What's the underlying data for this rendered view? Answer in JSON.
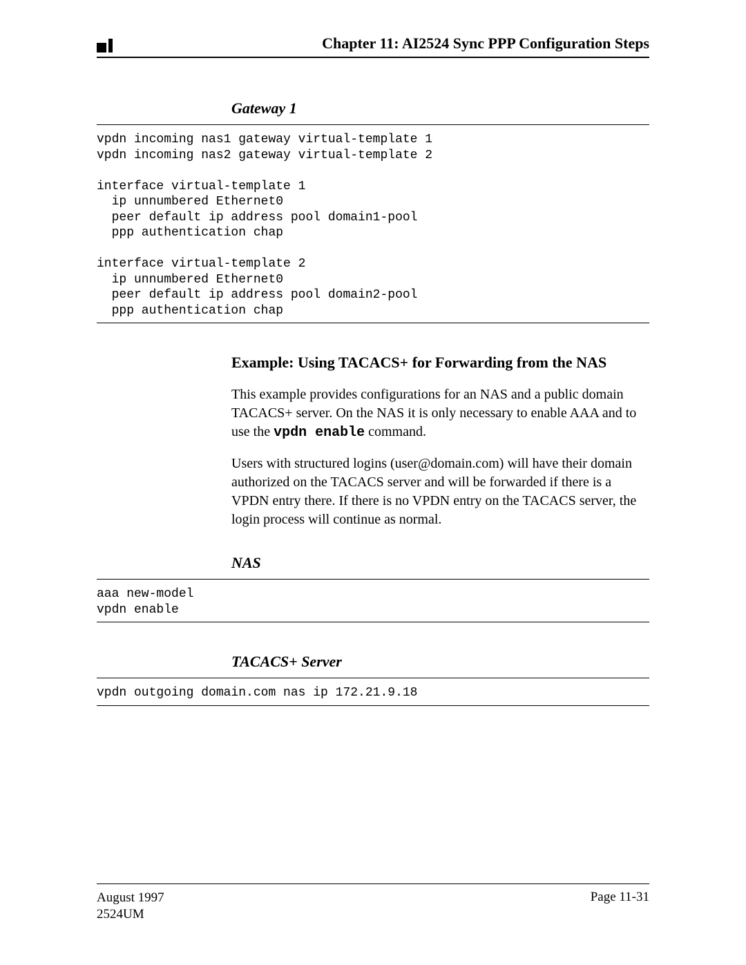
{
  "header": {
    "chapter_title": "Chapter 11: AI2524 Sync PPP Configuration Steps"
  },
  "sections": {
    "gateway1": {
      "heading": "Gateway 1",
      "code": "vpdn incoming nas1 gateway virtual-template 1\nvpdn incoming nas2 gateway virtual-template 2\n\ninterface virtual-template 1\n  ip unnumbered Ethernet0\n  peer default ip address pool domain1-pool\n  ppp authentication chap\n\ninterface virtual-template 2\n  ip unnumbered Ethernet0\n  peer default ip address pool domain2-pool\n  ppp authentication chap"
    },
    "example": {
      "heading": "Example: Using TACACS+ for Forwarding from the NAS",
      "p1_a": "This example provides configurations for an NAS and a public domain TACACS+ server. On the NAS it is only necessary to enable AAA and to use the ",
      "p1_code": "vpdn enable",
      "p1_b": " command.",
      "p2": "Users with structured logins (user@domain.com) will have their domain authorized on the TACACS server and will be forwarded if there is a VPDN entry there. If there is no VPDN entry on the TACACS server, the login process will continue as normal."
    },
    "nas": {
      "heading": "NAS",
      "code": "aaa new-model\nvpdn enable"
    },
    "tacacs": {
      "heading": "TACACS+ Server",
      "code": "vpdn outgoing domain.com nas ip 172.21.9.18"
    }
  },
  "footer": {
    "date": "August 1997",
    "doc": "2524UM",
    "page": "Page 11-31"
  }
}
